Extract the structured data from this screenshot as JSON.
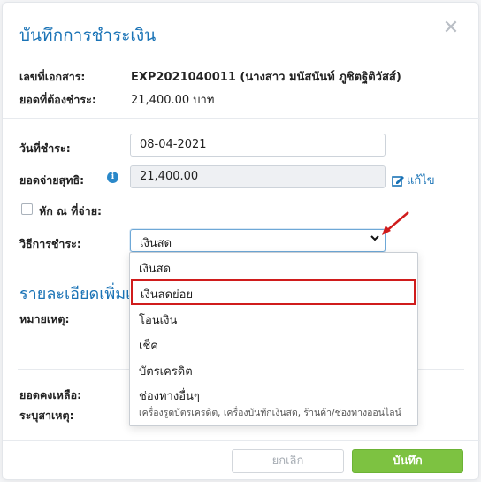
{
  "dialog": {
    "title": "บันทึกการชำระเงิน",
    "close_glyph": "✕"
  },
  "document": {
    "doc_no_label": "เลขที่เอกสาร:",
    "doc_no_value": "EXP2021040011 (นางสาว มนัสนันท์ ภูชิตฐิติวัสส์)",
    "amount_due_label": "ยอดที่ต้องชำระ:",
    "amount_due_value": "21,400.00 บาท"
  },
  "payment": {
    "date_label": "วันที่ชำระ:",
    "date_value": "08-04-2021",
    "net_label": "ยอดจ่ายสุทธิ:",
    "net_value": "21,400.00",
    "info_glyph": "i",
    "edit_label": "แก้ไข",
    "withholding_label": "หัก ณ ที่จ่าย:",
    "method_label": "วิธีการชำระ:",
    "method_value": "เงินสด"
  },
  "details": {
    "section_title": "รายละเอียดเพิ่มเติม",
    "note_label": "หมายเหตุ:",
    "balance_label": "ยอดคงเหลือ:",
    "reason_label": "ระบุสาเหตุ:"
  },
  "dropdown": {
    "options": [
      {
        "label": "เงินสด",
        "sub": ""
      },
      {
        "label": "เงินสดย่อย",
        "sub": ""
      },
      {
        "label": "โอนเงิน",
        "sub": ""
      },
      {
        "label": "เช็ค",
        "sub": ""
      },
      {
        "label": "บัตรเครดิต",
        "sub": ""
      },
      {
        "label": "ช่องทางอื่นๆ",
        "sub": "เครื่องรูดบัตรเครดิต, เครื่องบันทึกเงินสด, ร้านค้า/ช่องทางออนไลน์"
      }
    ],
    "highlighted_index": 1
  },
  "footer": {
    "cancel_label": "ยกเลิก",
    "save_label": "บันทึก"
  },
  "colors": {
    "accent": "#1a73b6",
    "save": "#7dc241",
    "highlight": "#d01c1c"
  }
}
